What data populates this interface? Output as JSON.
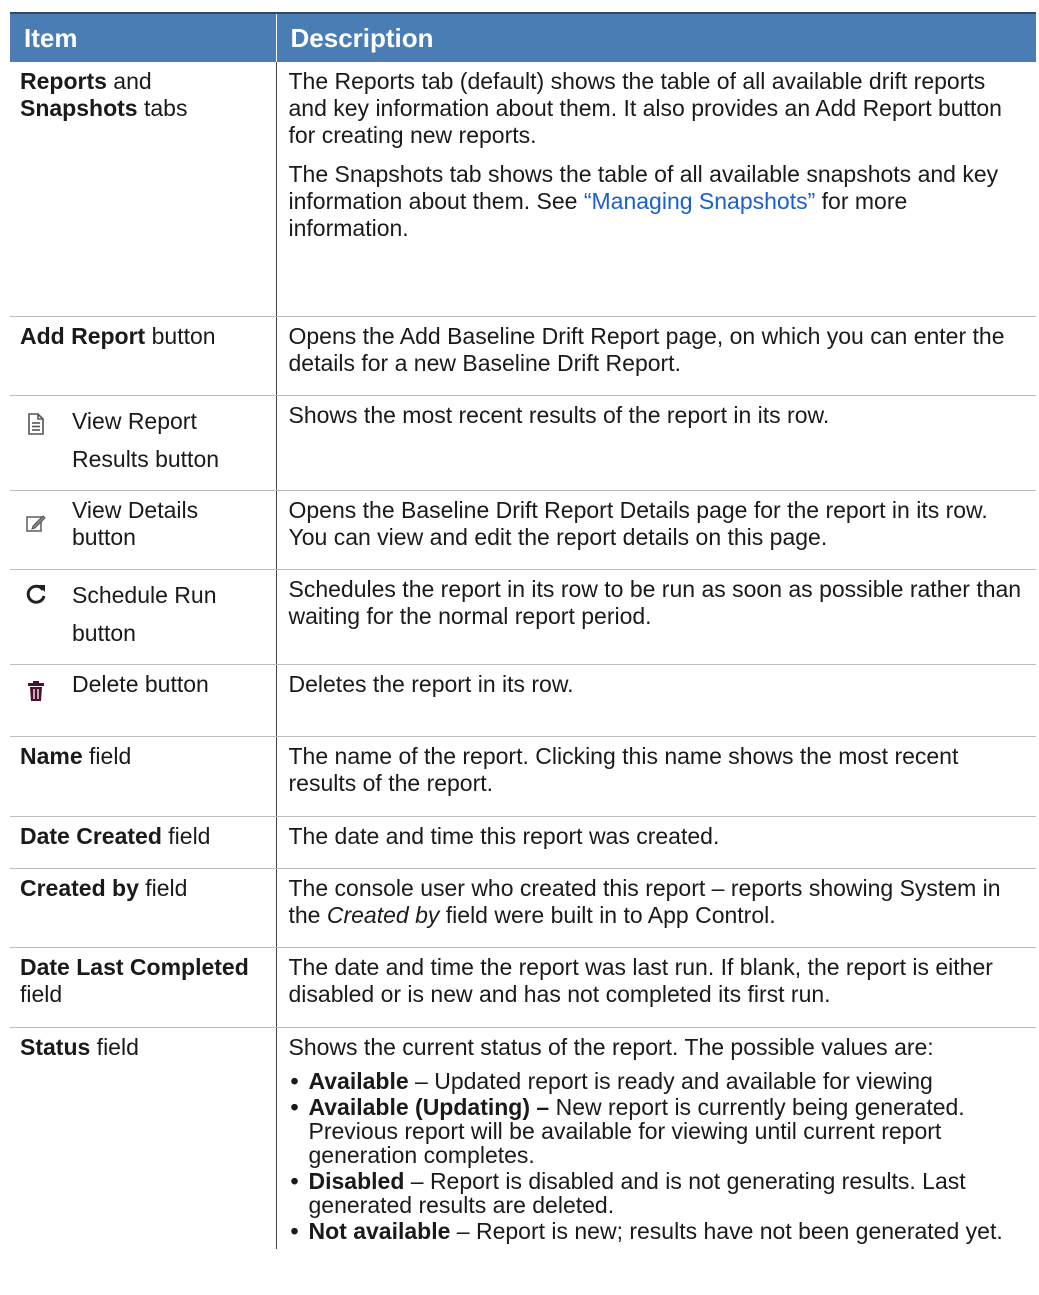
{
  "header": {
    "col1": "Item",
    "col2": "Description"
  },
  "rows": {
    "tabs": {
      "item_b1": "Reports",
      "item_t1": " and",
      "item_b2": "Snapshots",
      "item_t2": " tabs",
      "desc1": "The Reports tab (default) shows the table of all available drift reports and key information about them. It also provides an Add Report button for creating new reports.",
      "desc2_a": "The Snapshots tab shows the table of all available snapshots and key information about them. See ",
      "desc2_link": "“Managing Snapshots”",
      "desc2_b": " for more information."
    },
    "add_report": {
      "item_b": "Add Report",
      "item_t": " button",
      "desc": "Opens the Add Baseline Drift Report page, on which you can enter the details for a new Baseline Drift Report."
    },
    "view_results": {
      "icon": "report-document-icon",
      "item": "View Report Results button",
      "desc": "Shows the most recent results of the report in its row."
    },
    "view_details": {
      "icon": "edit-pencil-icon",
      "item": "View Details button",
      "desc": "Opens the Baseline Drift Report Details page for the report in its row. You can view and edit the report details on this page."
    },
    "schedule_run": {
      "icon": "refresh-icon",
      "item": "Schedule Run button",
      "desc": "Schedules the report in its row to be run as soon as possible rather than waiting for the normal report period."
    },
    "delete": {
      "icon": "trash-icon",
      "item": "Delete button",
      "desc": "Deletes the report in its row."
    },
    "name": {
      "item_b": "Name",
      "item_t": " field",
      "desc": "The name of the report. Clicking this name shows the most recent results of the report."
    },
    "date_created": {
      "item_b": "Date Created",
      "item_t": " field",
      "desc": "The date and time this report was created."
    },
    "created_by": {
      "item_b": "Created by",
      "item_t": " field",
      "desc_a": "The console user who created this report – reports showing System in the ",
      "desc_i": "Created by",
      "desc_b": " field were built in to App Control."
    },
    "date_last_completed": {
      "item_b": "Date Last Completed",
      "item_t": " field",
      "desc": "The date and time the report was last run. If blank, the report is either disabled or is new and has not completed its first run."
    },
    "status": {
      "item_b": "Status",
      "item_t": " field",
      "desc": "Shows the current status of the report. The possible values are:",
      "values": [
        {
          "term": "Available",
          "text": " – Updated report is ready and available for viewing"
        },
        {
          "term": "Available (Updating) –",
          "text": " New report is currently being generated. Previous report will be available for viewing until current report generation completes."
        },
        {
          "term": "Disabled",
          "text": " – Report is disabled and is not generating results. Last generated results are deleted."
        },
        {
          "term": "Not available",
          "text": " – Report is new; results have not been generated yet."
        }
      ]
    }
  },
  "colors": {
    "header_bg": "#4a7db3",
    "link": "#1a5fd1",
    "trash_icon": "#4a1030"
  }
}
